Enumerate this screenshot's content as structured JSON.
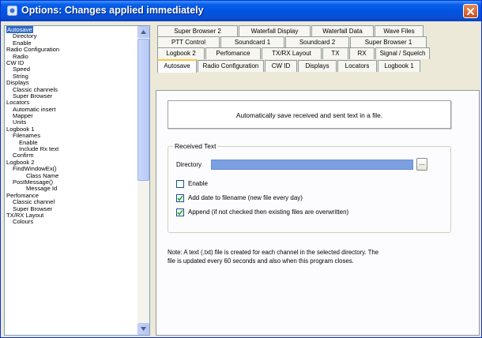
{
  "window": {
    "title": "Options: Changes applied immediately"
  },
  "tree": {
    "items": [
      {
        "label": "Autosave",
        "level": 0,
        "selected": true
      },
      {
        "label": "Directory",
        "level": 1
      },
      {
        "label": "Enable",
        "level": 1
      },
      {
        "label": "Radio Configuration",
        "level": 0
      },
      {
        "label": "Radio",
        "level": 1
      },
      {
        "label": "CW ID",
        "level": 0
      },
      {
        "label": "Speed",
        "level": 1
      },
      {
        "label": "String",
        "level": 1
      },
      {
        "label": "Displays",
        "level": 0
      },
      {
        "label": "Classic channels",
        "level": 1
      },
      {
        "label": "Super Browser",
        "level": 1
      },
      {
        "label": "Locators",
        "level": 0
      },
      {
        "label": "Automatic insert",
        "level": 1
      },
      {
        "label": "Mapper",
        "level": 1
      },
      {
        "label": "Units",
        "level": 1
      },
      {
        "label": "Logbook 1",
        "level": 0
      },
      {
        "label": "Filenames",
        "level": 1
      },
      {
        "label": "Enable",
        "level": 2
      },
      {
        "label": "Include Rx text",
        "level": 2
      },
      {
        "label": "Confirm",
        "level": 1
      },
      {
        "label": "Logbook 2",
        "level": 0
      },
      {
        "label": "FindWindowEx()",
        "level": 1
      },
      {
        "label": "Class Name",
        "level": 3
      },
      {
        "label": "PostMessage()",
        "level": 1
      },
      {
        "label": "Message Id",
        "level": 3
      },
      {
        "label": "Perfomance",
        "level": 0
      },
      {
        "label": "Classic channel",
        "level": 1
      },
      {
        "label": "Super Browser",
        "level": 1
      },
      {
        "label": "TX/RX Layout",
        "level": 0
      },
      {
        "label": "Colours",
        "level": 1
      }
    ]
  },
  "tabs": {
    "rows": [
      [
        "Super Browser 2",
        "Waterfall Display",
        "Waterfall Data",
        "Wave Files"
      ],
      [
        "PTT Control",
        "Soundcard 1",
        "Soundcard 2",
        "Super Browser 1"
      ],
      [
        "Logbook 2",
        "Perfomance",
        "TX/RX Layout",
        "TX",
        "RX",
        "Signal / Squelch"
      ],
      [
        "Autosave",
        "Radio Configuration",
        "CW ID",
        "Displays",
        "Locators",
        "Logbook 1"
      ]
    ],
    "active": "Autosave"
  },
  "panel": {
    "description": "Automatically save received and sent text in a file.",
    "group_title": "Received Text",
    "directory_label": "Directory",
    "directory_value": "",
    "browse_label": "...",
    "checkboxes": [
      {
        "label": "Enable",
        "checked": false
      },
      {
        "label": "Add date to filename (new file every day)",
        "checked": true
      },
      {
        "label": "Append (if not checked then existing files are overwritten)",
        "checked": true
      }
    ],
    "note_lines": [
      "Note: A text (.txt) file is created for each channel in the selected directory. The",
      "file is updated every 60 seconds and also when this program closes."
    ]
  },
  "colors": {
    "titlebar": "#0054e3",
    "selection": "#316ac5",
    "directory_field": "#7b9fe0",
    "active_tab_accent": "#ffc83c"
  }
}
